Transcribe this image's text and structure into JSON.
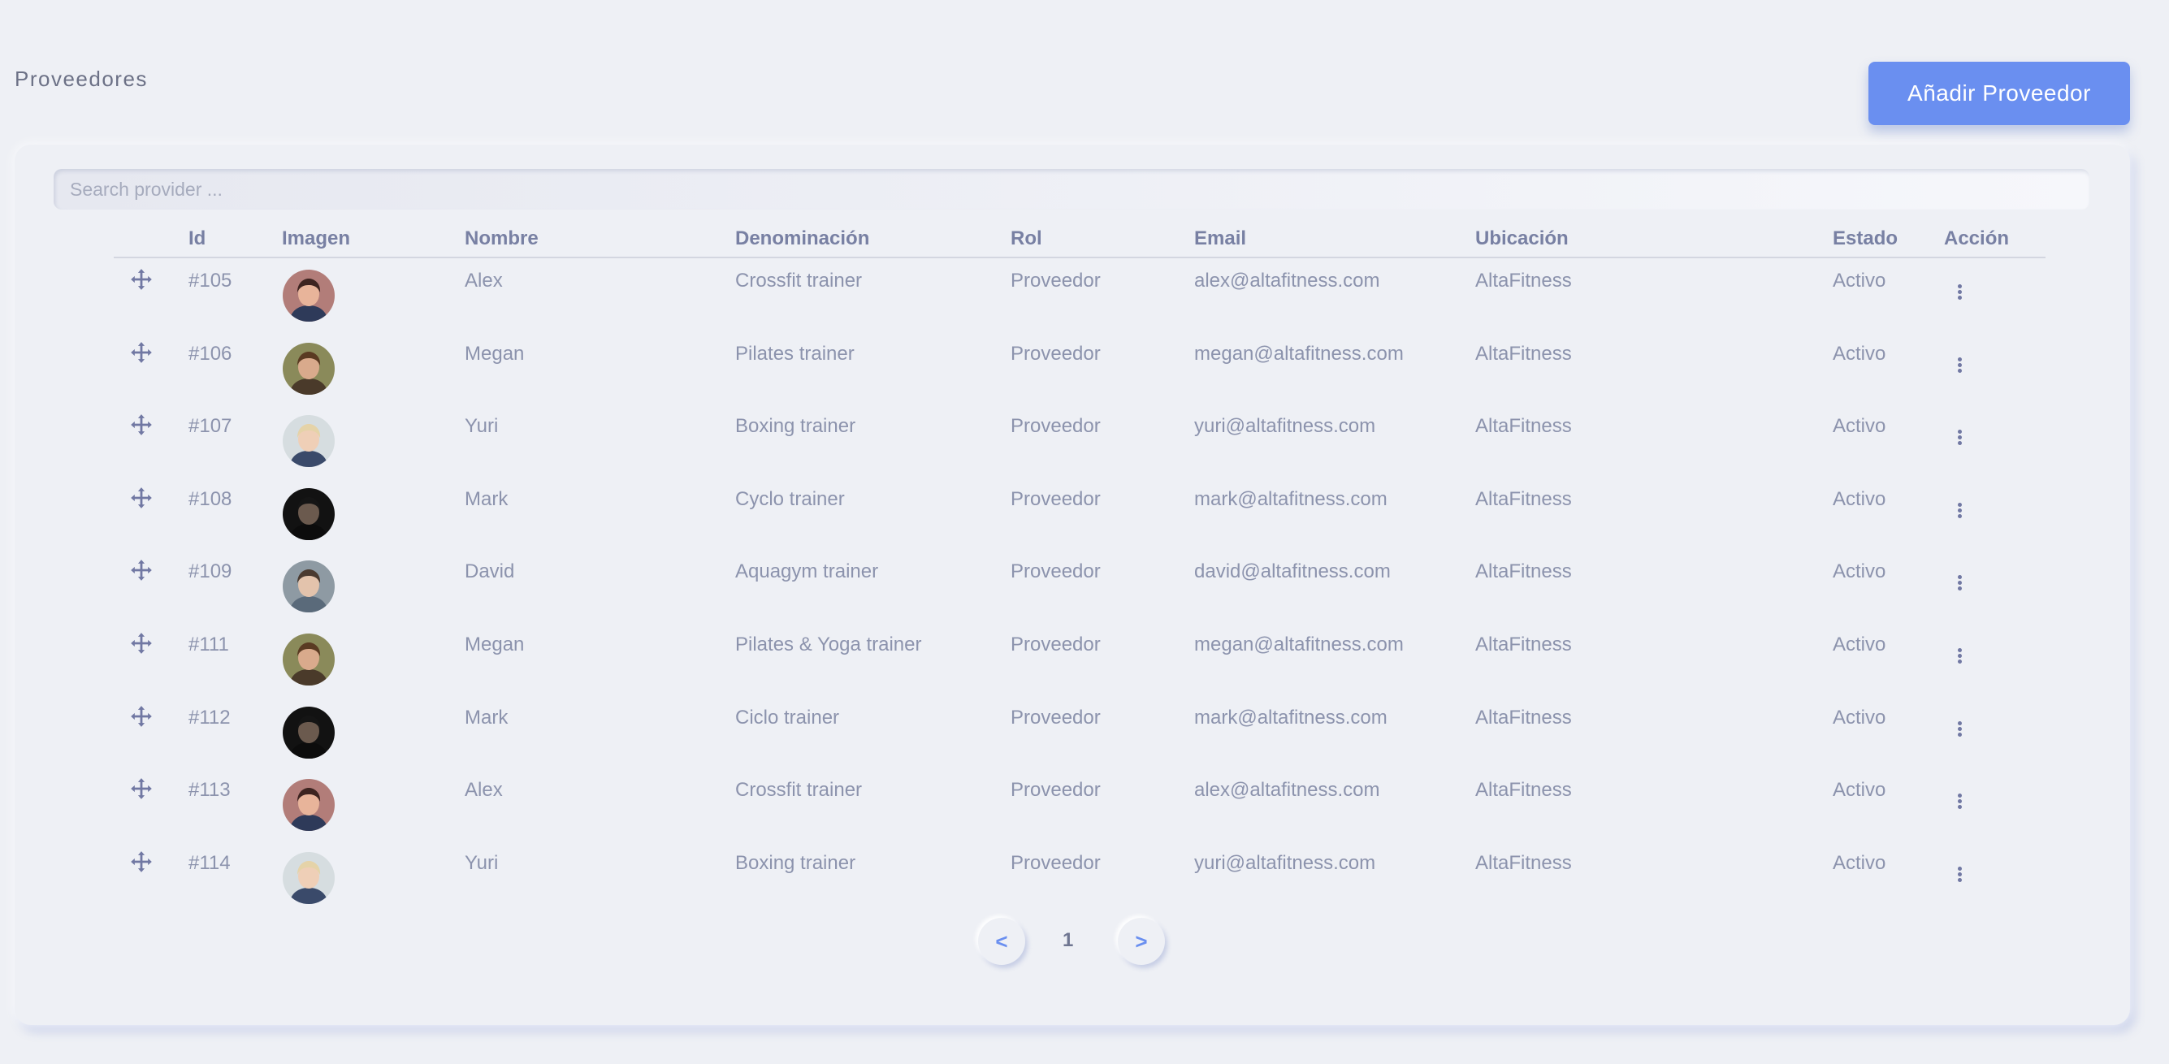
{
  "page": {
    "title": "Proveedores",
    "add_button": "Añadir Proveedor"
  },
  "search": {
    "placeholder": "Search provider ..."
  },
  "table": {
    "headers": {
      "id": "Id",
      "image": "Imagen",
      "name": "Nombre",
      "denomination": "Denominación",
      "role": "Rol",
      "email": "Email",
      "location": "Ubicación",
      "status": "Estado",
      "action": "Acción"
    },
    "rows": [
      {
        "id": "#105",
        "avatar": "avatar-alex",
        "name": "Alex",
        "denomination": "Crossfit trainer",
        "role": "Proveedor",
        "email": "alex@altafitness.com",
        "location": "AltaFitness",
        "status": "Activo"
      },
      {
        "id": "#106",
        "avatar": "avatar-megan",
        "name": "Megan",
        "denomination": "Pilates trainer",
        "role": "Proveedor",
        "email": "megan@altafitness.com",
        "location": "AltaFitness",
        "status": "Activo"
      },
      {
        "id": "#107",
        "avatar": "avatar-yuri",
        "name": "Yuri",
        "denomination": "Boxing trainer",
        "role": "Proveedor",
        "email": "yuri@altafitness.com",
        "location": "AltaFitness",
        "status": "Activo"
      },
      {
        "id": "#108",
        "avatar": "avatar-mark",
        "name": "Mark",
        "denomination": "Cyclo trainer",
        "role": "Proveedor",
        "email": "mark@altafitness.com",
        "location": "AltaFitness",
        "status": "Activo"
      },
      {
        "id": "#109",
        "avatar": "avatar-david",
        "name": "David",
        "denomination": "Aquagym trainer",
        "role": "Proveedor",
        "email": "david@altafitness.com",
        "location": "AltaFitness",
        "status": "Activo"
      },
      {
        "id": "#111",
        "avatar": "avatar-megan",
        "name": "Megan",
        "denomination": "Pilates & Yoga trainer",
        "role": "Proveedor",
        "email": "megan@altafitness.com",
        "location": "AltaFitness",
        "status": "Activo"
      },
      {
        "id": "#112",
        "avatar": "avatar-mark",
        "name": "Mark",
        "denomination": "Ciclo trainer",
        "role": "Proveedor",
        "email": "mark@altafitness.com",
        "location": "AltaFitness",
        "status": "Activo"
      },
      {
        "id": "#113",
        "avatar": "avatar-alex",
        "name": "Alex",
        "denomination": "Crossfit trainer",
        "role": "Proveedor",
        "email": "alex@altafitness.com",
        "location": "AltaFitness",
        "status": "Activo"
      },
      {
        "id": "#114",
        "avatar": "avatar-yuri",
        "name": "Yuri",
        "denomination": "Boxing trainer",
        "role": "Proveedor",
        "email": "yuri@altafitness.com",
        "location": "AltaFitness",
        "status": "Activo"
      }
    ]
  },
  "pagination": {
    "prev": "<",
    "current": "1",
    "next": ">"
  },
  "icons": {
    "drag": "move-icon",
    "actions": "more-vertical-icon"
  },
  "colors": {
    "accent": "#6a8ff0",
    "background": "#eef0f5",
    "text": "#8c93ad",
    "header_text": "#7880a3"
  }
}
